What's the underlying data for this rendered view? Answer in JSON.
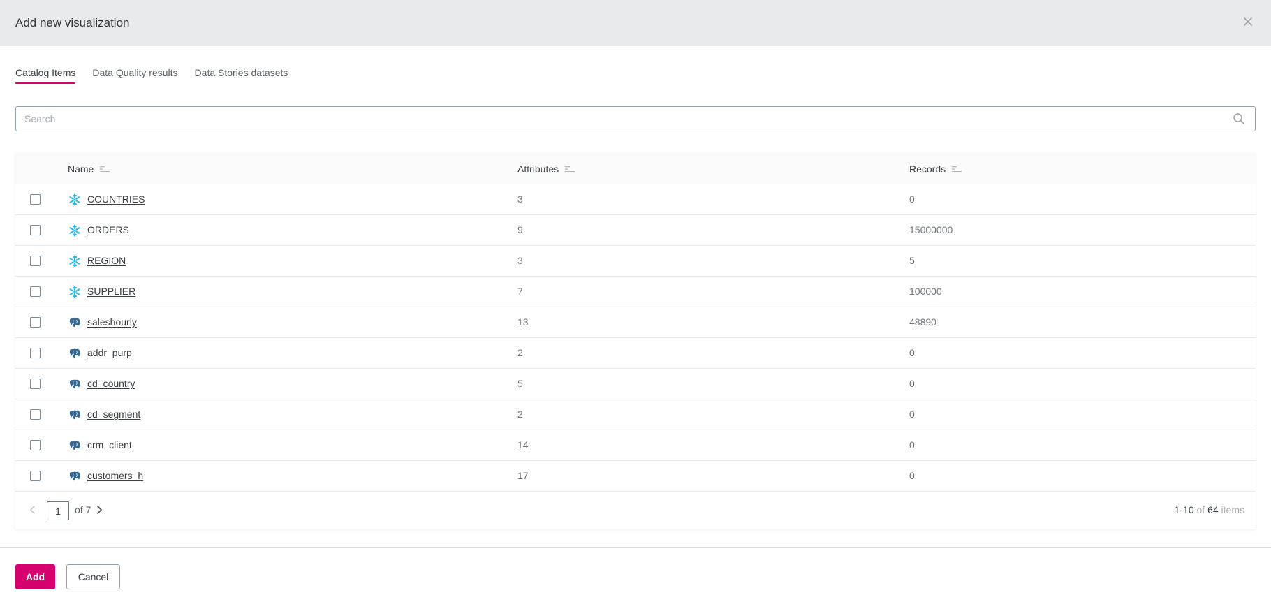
{
  "dialog": {
    "title": "Add new visualization",
    "close_icon": "close-icon"
  },
  "tabs": [
    {
      "label": "Catalog Items",
      "active": true
    },
    {
      "label": "Data Quality results",
      "active": false
    },
    {
      "label": "Data Stories datasets",
      "active": false
    }
  ],
  "search": {
    "placeholder": "Search",
    "value": "",
    "icon": "search-icon"
  },
  "table": {
    "columns": [
      {
        "label": "Name",
        "sort_icon": "sort-icon"
      },
      {
        "label": "Attributes",
        "sort_icon": "sort-icon"
      },
      {
        "label": "Records",
        "sort_icon": "sort-icon"
      }
    ],
    "rows": [
      {
        "name": "COUNTRIES",
        "source": "snowflake",
        "attributes": "3",
        "records": "0",
        "checked": false
      },
      {
        "name": "ORDERS",
        "source": "snowflake",
        "attributes": "9",
        "records": "15000000",
        "checked": false
      },
      {
        "name": "REGION",
        "source": "snowflake",
        "attributes": "3",
        "records": "5",
        "checked": false
      },
      {
        "name": "SUPPLIER",
        "source": "snowflake",
        "attributes": "7",
        "records": "100000",
        "checked": false
      },
      {
        "name": "saleshourly",
        "source": "postgresql",
        "attributes": "13",
        "records": "48890",
        "checked": false
      },
      {
        "name": "addr_purp",
        "source": "postgresql",
        "attributes": "2",
        "records": "0",
        "checked": false
      },
      {
        "name": "cd_country",
        "source": "postgresql",
        "attributes": "5",
        "records": "0",
        "checked": false
      },
      {
        "name": "cd_segment",
        "source": "postgresql",
        "attributes": "2",
        "records": "0",
        "checked": false
      },
      {
        "name": "crm_client",
        "source": "postgresql",
        "attributes": "14",
        "records": "0",
        "checked": false
      },
      {
        "name": "customers_h",
        "source": "postgresql",
        "attributes": "17",
        "records": "0",
        "checked": false
      }
    ]
  },
  "pagination": {
    "current_page": "1",
    "of_label": "of 7",
    "range": "1-10",
    "of_word": "of",
    "total": "64",
    "items_word": "items"
  },
  "footer": {
    "add_label": "Add",
    "cancel_label": "Cancel"
  },
  "colors": {
    "accent": "#d6006f",
    "header_bg": "#e7ebee",
    "snowflake": "#29b5e8",
    "postgresql": "#336791"
  }
}
